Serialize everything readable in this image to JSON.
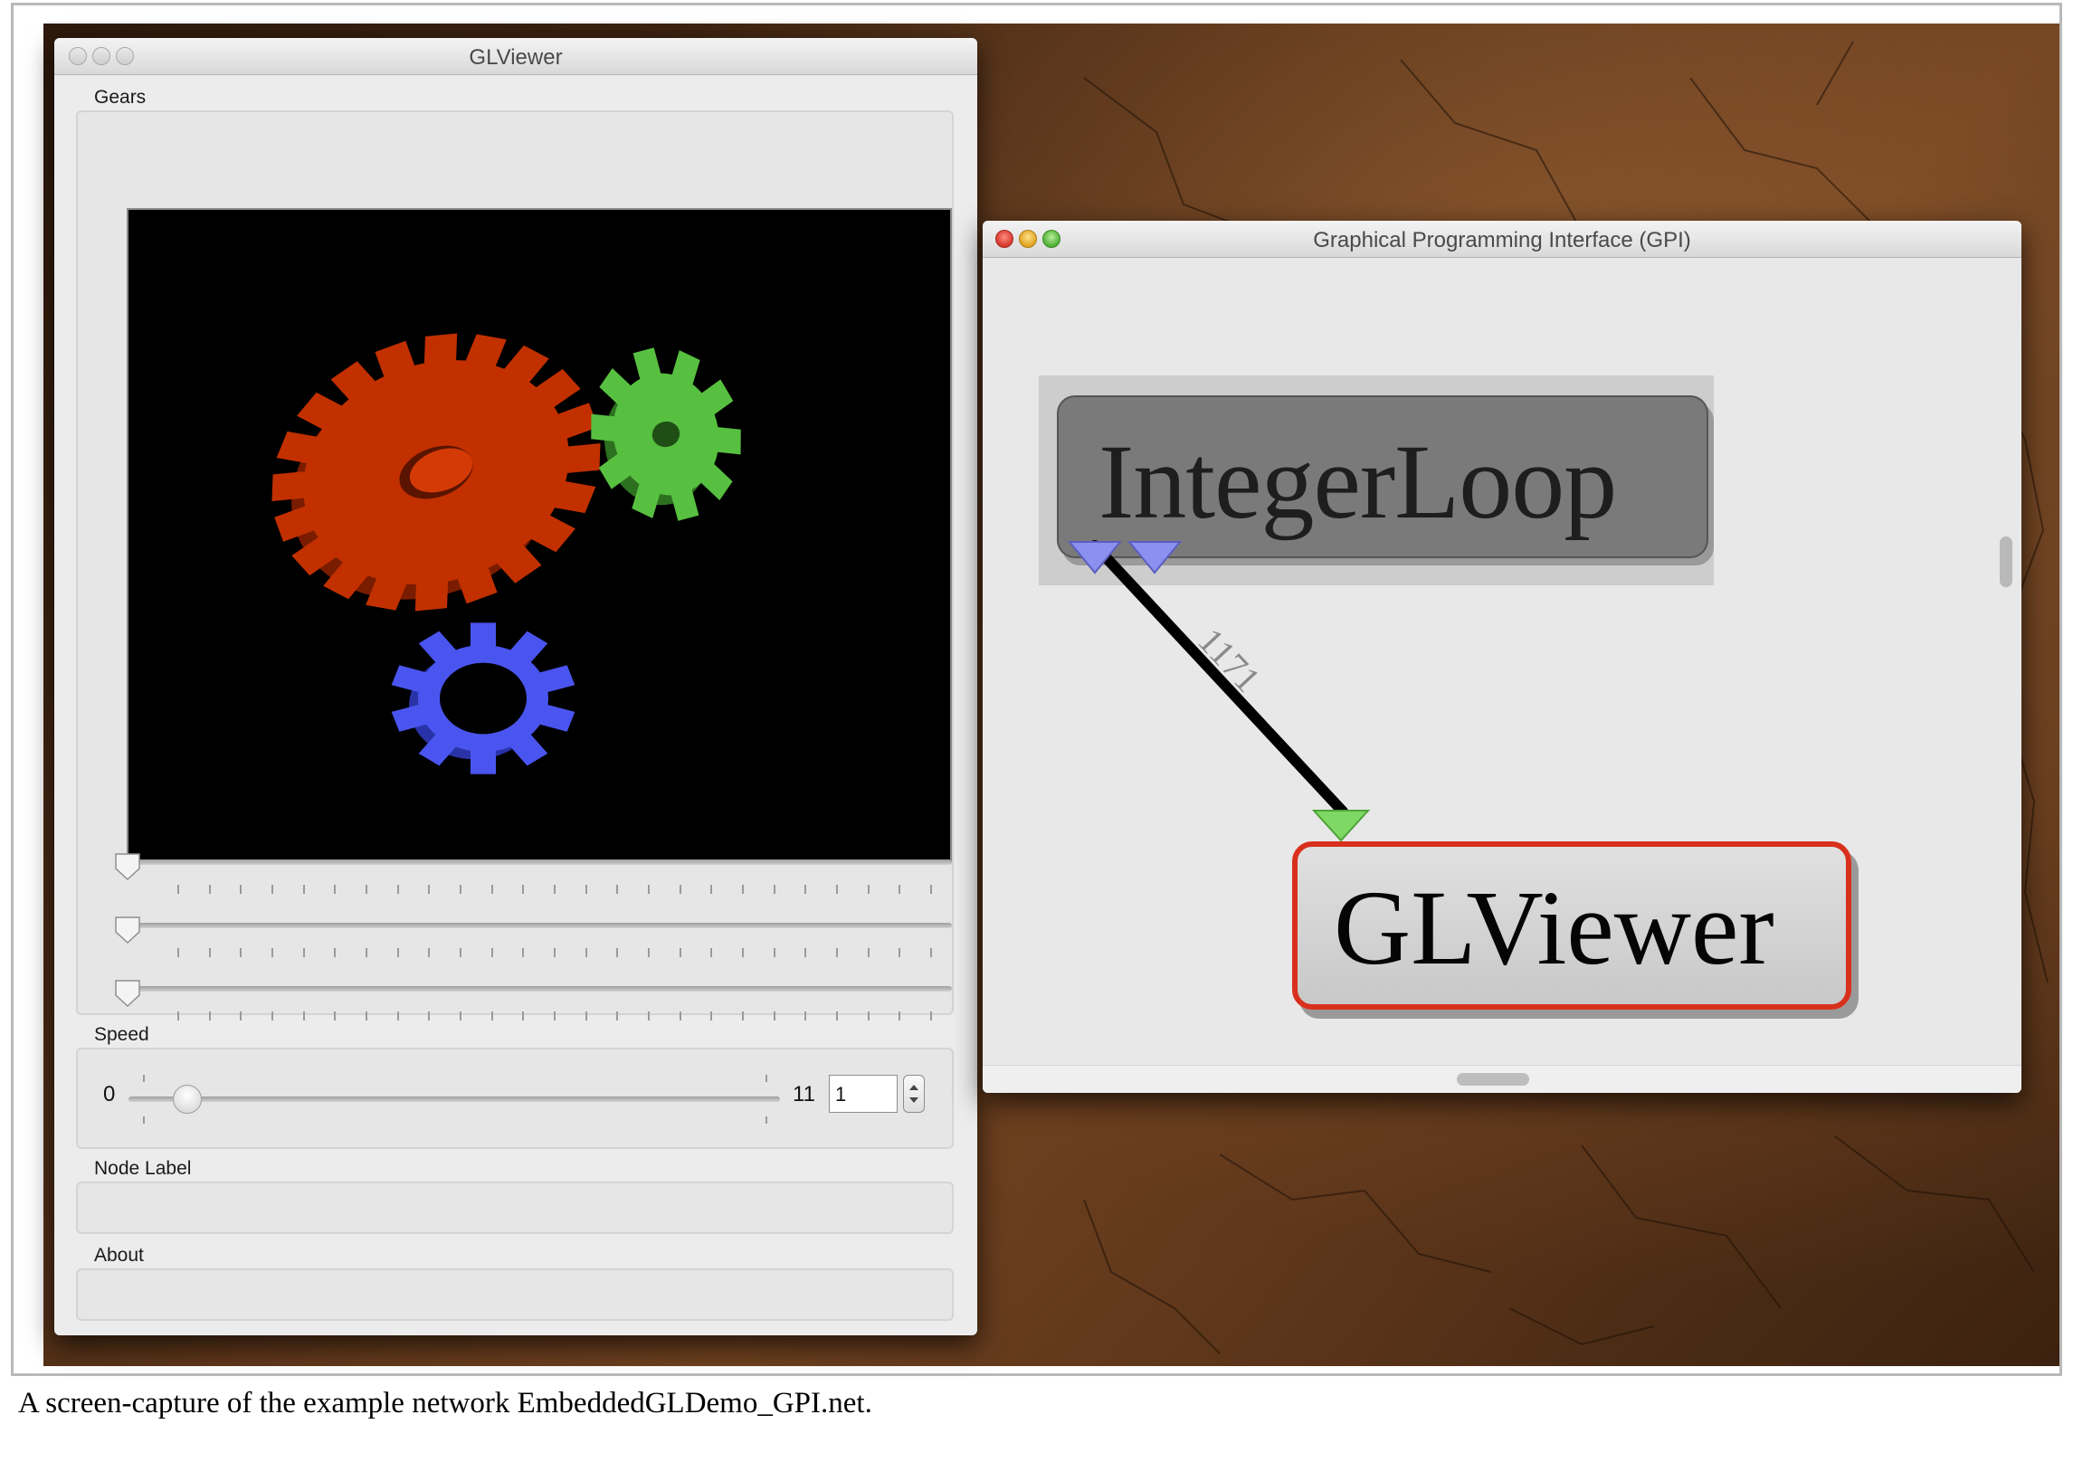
{
  "caption": "A screen-capture of the example network EmbeddedGLDemo_GPI.net.",
  "glviewer_window": {
    "title": "GLViewer",
    "sections": {
      "gears": "Gears",
      "speed": "Speed",
      "node_label": "Node Label",
      "about": "About"
    },
    "gear_sliders": [
      {
        "name": "rotation-x",
        "value": 0
      },
      {
        "name": "rotation-y",
        "value": 0
      },
      {
        "name": "rotation-z",
        "value": 0
      }
    ],
    "speed": {
      "min_label": "0",
      "max_label": "11",
      "value": "1"
    },
    "node_label_value": "",
    "about_value": ""
  },
  "gpi_window": {
    "title": "Graphical Programming Interface (GPI)",
    "nodes": [
      {
        "label": "IntegerLoop"
      },
      {
        "label": "GLViewer"
      }
    ],
    "connection_label": "1171"
  },
  "colors": {
    "gear_red": "#c23000",
    "gear_green": "#58c040",
    "gear_blue": "#4a55f0",
    "port_out": "#8c90ee",
    "port_in": "#7fd864",
    "selected_node_border": "#d8301c"
  }
}
